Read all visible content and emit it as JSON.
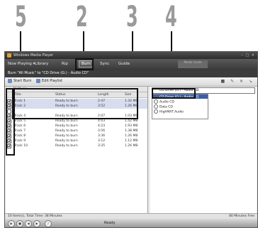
{
  "callouts": [
    "5",
    "2",
    "3",
    "4"
  ],
  "window": {
    "title": "Windows Media Player",
    "controls": "–  □  ✕"
  },
  "nav": {
    "items": [
      "Now Playing ▾",
      "Library",
      "Rip",
      "Burn",
      "Sync",
      "Guide"
    ],
    "ghost_tab": "Media Guide"
  },
  "burnbar": {
    "title": "Burn \"All Music\" to \"CD Drive (G:) - Audio CD\"",
    "drive_label": "Audio CD"
  },
  "toolbar": {
    "start_burn": "Start Burn",
    "edit_playlist": "Edit Playlist",
    "right_icons": "■ ✎ ✕ ↘"
  },
  "left": {
    "list_name": "All Music",
    "headers": {
      "title": "Title",
      "status": "Status",
      "length": "Length",
      "size": "Size"
    },
    "rows": [
      {
        "title": "Track 1",
        "status": "Ready to burn",
        "length": "2:47",
        "size": "1.32 MB",
        "checked": true
      },
      {
        "title": "Track 2",
        "status": "Ready to burn",
        "length": "3:52",
        "size": "1.26 MB",
        "checked": true
      },
      {
        "title": "",
        "status": "",
        "length": "",
        "size": "",
        "checked": false
      },
      {
        "title": "Track 4",
        "status": "Ready to burn",
        "length": "2:07",
        "size": "1.03 MB",
        "checked": true
      },
      {
        "title": "Track 5",
        "status": "Ready to burn",
        "length": "4:03",
        "size": "1.42 MB",
        "checked": true
      },
      {
        "title": "Track 6",
        "status": "Ready to burn",
        "length": "4:23",
        "size": "1.93 MB",
        "checked": true
      },
      {
        "title": "Track 7",
        "status": "Ready to burn",
        "length": "3:56",
        "size": "1.38 MB",
        "checked": true
      },
      {
        "title": "Track 8",
        "status": "Ready to burn",
        "length": "3:36",
        "size": "1.26 MB",
        "checked": true
      },
      {
        "title": "Track 9",
        "status": "Ready to burn",
        "length": "3:12",
        "size": "1.12 MB",
        "checked": true
      },
      {
        "title": "Track 10",
        "status": "Ready to burn",
        "length": "3:35",
        "size": "1.26 MB",
        "checked": true
      }
    ]
  },
  "right": {
    "selected_drive": "CD Drive (G:) - Audio CD",
    "options": [
      "CD Drive (G:) - Audio CD",
      "Audio CD",
      "Data CD",
      "HighMAT Audio"
    ]
  },
  "status": {
    "left": "10 Item(s), Total Time: 38 Minutes",
    "right": "80 Minutes Free"
  },
  "player": {
    "state": "Ready"
  }
}
